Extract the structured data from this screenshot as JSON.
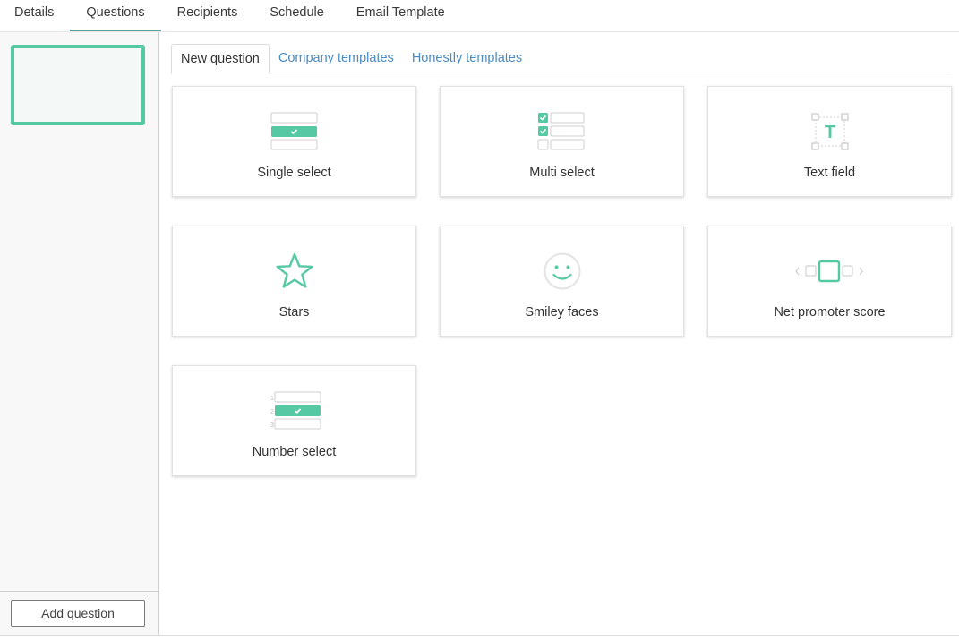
{
  "tabs": [
    "Details",
    "Questions",
    "Recipients",
    "Schedule",
    "Email Template"
  ],
  "sidebar": {
    "add_question_label": "Add question"
  },
  "sub_tabs": [
    "New question",
    "Company templates",
    "Honestly templates"
  ],
  "question_types": [
    {
      "label": "Single select",
      "icon": "single-select-icon"
    },
    {
      "label": "Multi select",
      "icon": "multi-select-icon"
    },
    {
      "label": "Text field",
      "icon": "text-field-icon"
    },
    {
      "label": "Stars",
      "icon": "star-icon"
    },
    {
      "label": "Smiley faces",
      "icon": "smiley-face-icon"
    },
    {
      "label": "Net promoter score",
      "icon": "net-promoter-score-icon"
    },
    {
      "label": "Number select",
      "icon": "number-select-icon"
    }
  ],
  "icon_text": {
    "text_field_letter": "T",
    "numbers": [
      "1",
      "2",
      "3"
    ]
  },
  "colors": {
    "accent": "#56c9a4",
    "link": "#4a8ac4",
    "active_tab_underline": "#5a9fa0"
  }
}
